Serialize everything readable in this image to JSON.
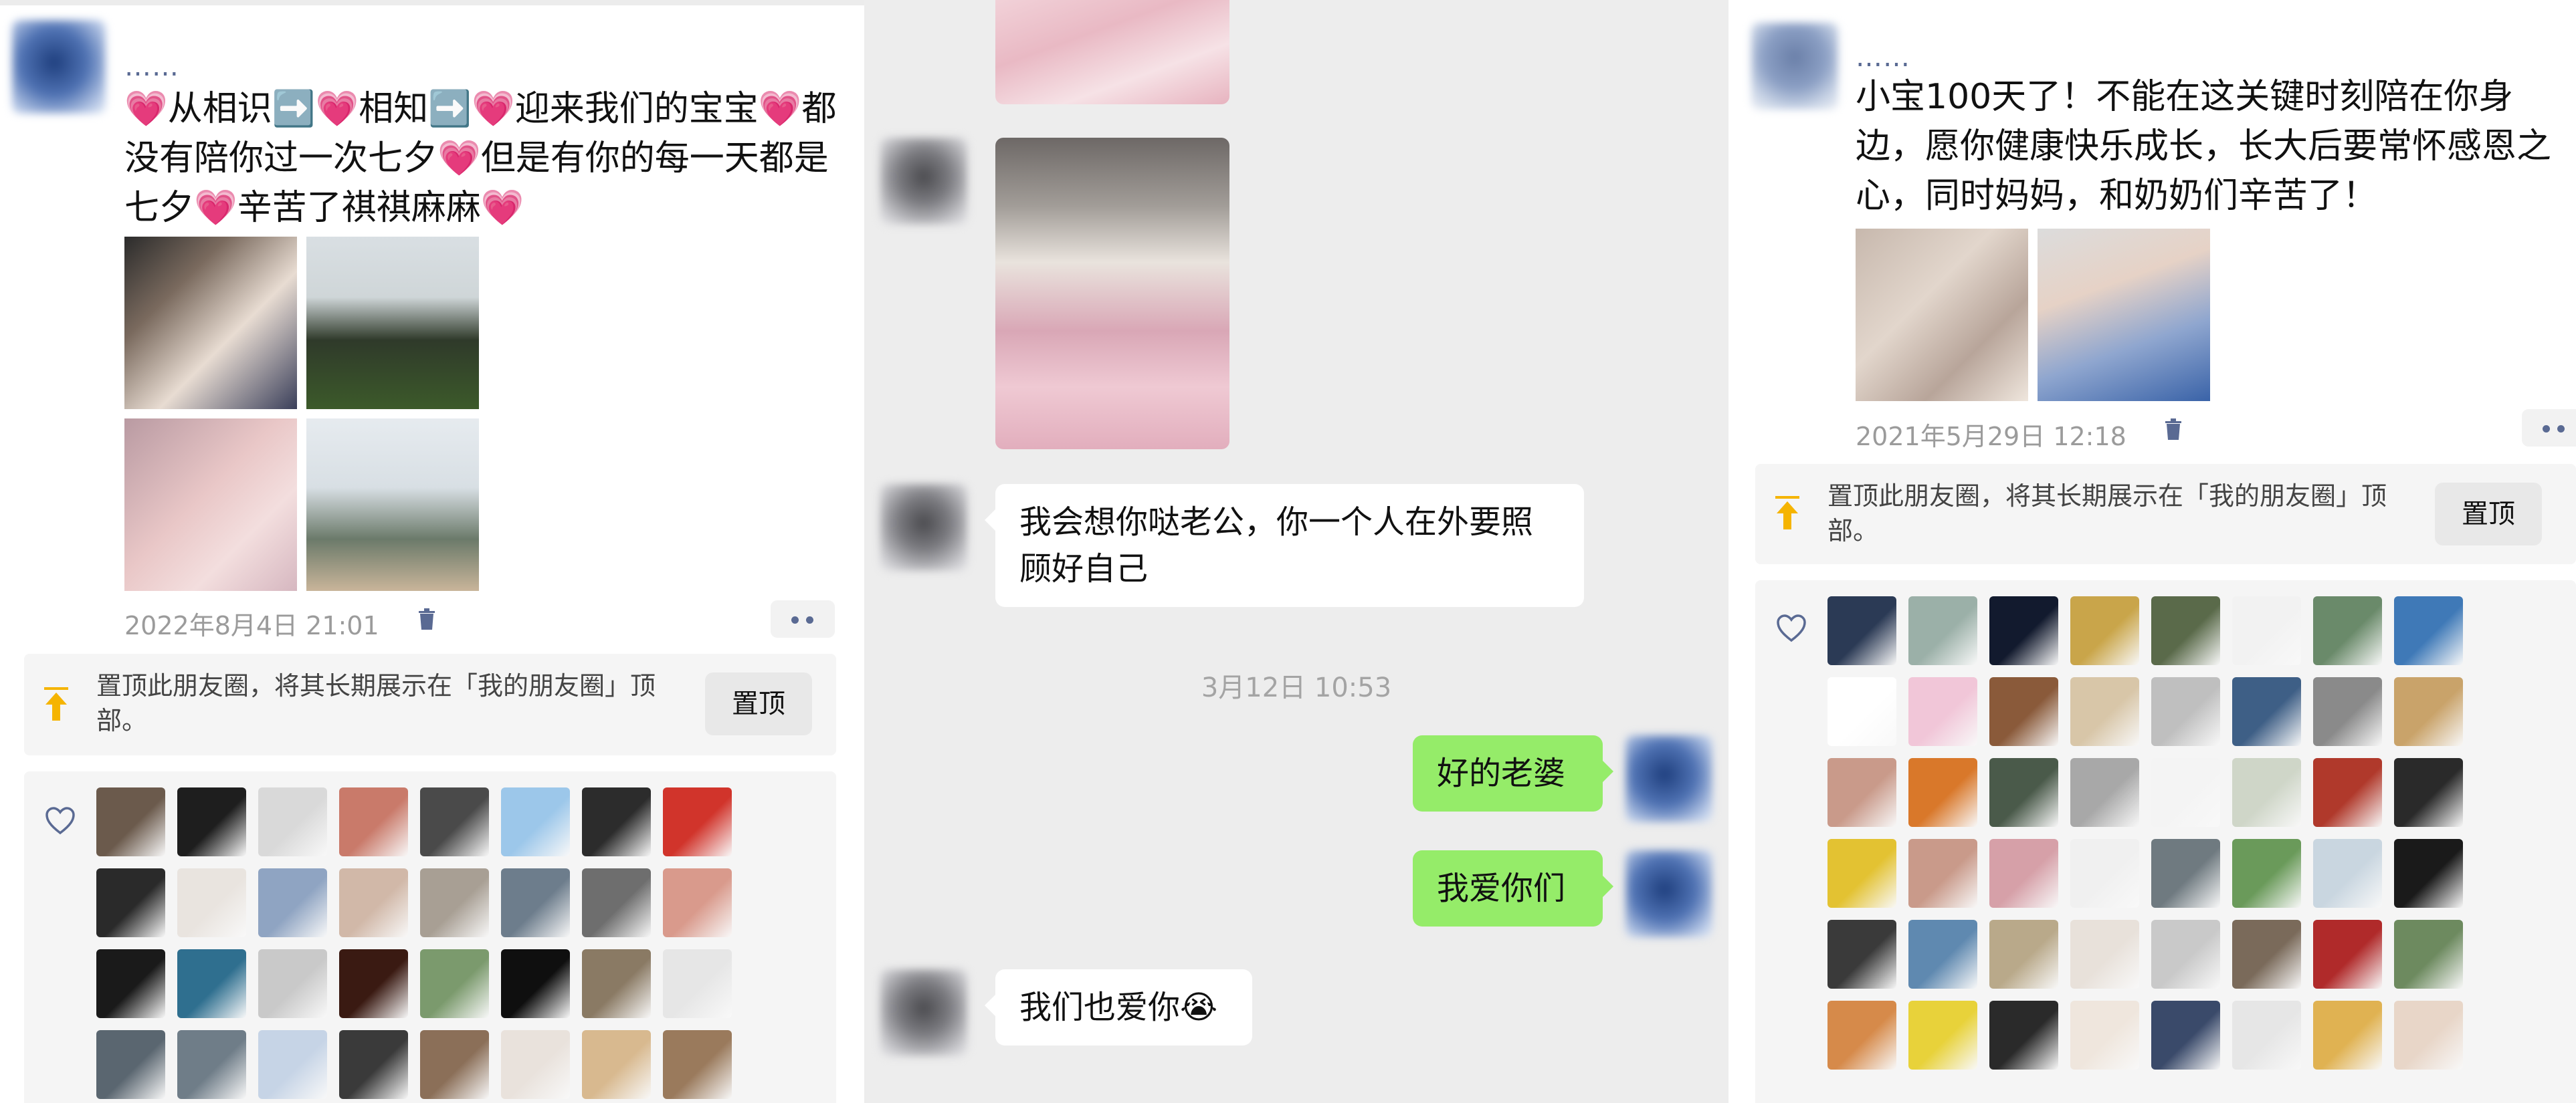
{
  "panel_left": {
    "nickname": "……",
    "post_text": "💗从相识➡️💗相知➡️💗迎来我们的宝宝💗都没有陪你过一次七夕💗但是有你的每一天都是七夕💗辛苦了祺祺麻麻💗",
    "timestamp": "2022年8月4日 21:01",
    "pin_text": "置顶此朋友圈，将其长期展示在「我的朋友圈」顶部。",
    "pin_button": "置顶",
    "photo_count": 4,
    "liker_count": 32
  },
  "panel_chat": {
    "messages": [
      {
        "sender": "wife",
        "type": "text",
        "text": "我会想你哒老公，你一个人在外要照顾好自己"
      },
      {
        "type": "time",
        "text": "3月12日 10:53"
      },
      {
        "sender": "me",
        "type": "text",
        "text": "好的老婆"
      },
      {
        "sender": "me",
        "type": "text",
        "text": "我爱你们"
      },
      {
        "sender": "wife",
        "type": "text",
        "text": "我们也爱你😭"
      }
    ]
  },
  "panel_right": {
    "nickname": "……",
    "post_text": "小宝100天了！不能在这关键时刻陪在你身边，愿你健康快乐成长，长大后要常怀感恩之心，同时妈妈，和奶奶们辛苦了！",
    "timestamp": "2021年5月29日 12:18",
    "pin_text": "置顶此朋友圈，将其长期展示在「我的朋友圈」顶部。",
    "pin_button": "置顶",
    "photo_count": 2,
    "liker_count": 48
  },
  "colors": {
    "accent_name": "#5a6a93",
    "bubble_green": "#95ec69",
    "chat_bg": "#ededed",
    "pin_arrow": "#f5b400"
  },
  "icons": [
    "heart-outline-icon",
    "trash-icon",
    "pin-top-icon",
    "more-dots-icon"
  ]
}
